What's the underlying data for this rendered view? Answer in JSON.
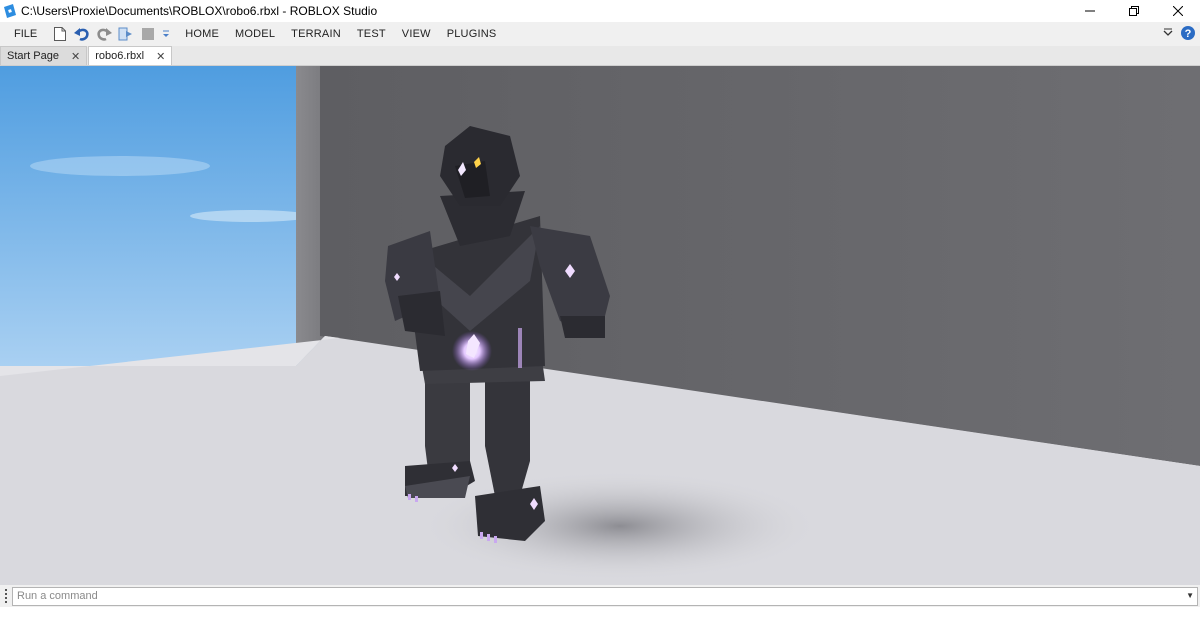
{
  "window": {
    "title": "C:\\Users\\Proxie\\Documents\\ROBLOX\\robo6.rbxl - ROBLOX Studio"
  },
  "menubar": {
    "file_label": "FILE",
    "tabs": [
      {
        "label": "HOME"
      },
      {
        "label": "MODEL"
      },
      {
        "label": "TERRAIN"
      },
      {
        "label": "TEST"
      },
      {
        "label": "VIEW"
      },
      {
        "label": "PLUGINS"
      }
    ],
    "quick_access_icons": [
      "new-file-icon",
      "undo-icon",
      "redo-icon",
      "import-icon",
      "stop-icon",
      "customize-dropdown-icon"
    ]
  },
  "document_tabs": [
    {
      "label": "Start Page",
      "active": false
    },
    {
      "label": "robo6.rbxl",
      "active": true
    }
  ],
  "command_bar": {
    "placeholder": "Run a command"
  },
  "colors": {
    "sky": "#6fb0e6",
    "wall": "#6b6b6f",
    "floor": "#d7d7dc",
    "robot": "#3a3a40",
    "glow": "#d9b6ff",
    "help_icon": "#2b6cc4"
  }
}
